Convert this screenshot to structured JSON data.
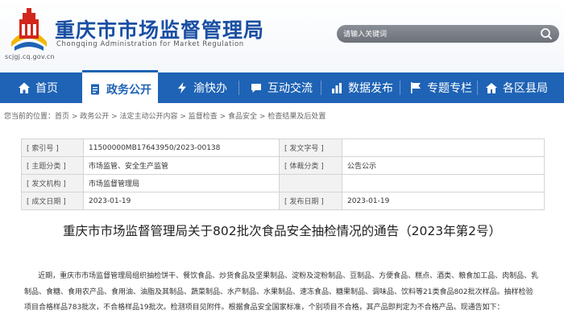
{
  "header": {
    "site_title": "重庆市市场监督管理局",
    "site_subtitle": "Chongqing  Administration  for  Market  Regulation",
    "domain": "scjgj.cq.gov.cn",
    "logo_icon": "city-landmark-logo-icon",
    "colors": {
      "primary": "#1e63b5",
      "logo_red": "#d2261d",
      "logo_yellow": "#f2b705"
    }
  },
  "search": {
    "placeholder": "请输入关键词",
    "icon": "search-icon"
  },
  "nav": {
    "items": [
      {
        "label": "首页",
        "icon": "home-icon"
      },
      {
        "label": "政务公开",
        "icon": "document-icon",
        "active": true
      },
      {
        "label": "渝快办",
        "icon": "lightning-icon"
      },
      {
        "label": "互动交流",
        "icon": "chat-icon"
      },
      {
        "label": "数据发布",
        "icon": "chart-icon"
      },
      {
        "label": "专题专栏",
        "icon": "flag-icon"
      },
      {
        "label": "各区县局",
        "icon": "building-icon"
      }
    ]
  },
  "breadcrumb": "您当前的位置：首页 > 政务公开 > 法定主动公开内容 > 监督检查 > 食品安全 > 检查结果及后处置",
  "info_table": {
    "rows": [
      {
        "label1": "[ 索引号 ]",
        "value1": "11500000MB17643950/2023-00138",
        "label2": "[ 发文字号 ]",
        "value2": ""
      },
      {
        "label1": "[ 主题分类 ]",
        "value1": "市场监管、安全生产监管",
        "label2": "[ 体裁分类 ]",
        "value2": "公告公示"
      },
      {
        "label1": "[ 发文机构 ]",
        "value1": "市场监督管理局",
        "label2": "",
        "value2": ""
      },
      {
        "label1": "[ 成文日期 ]",
        "value1": "2023-01-19",
        "label2": "[ 发布日期 ]",
        "value2": "2023-01-19"
      }
    ]
  },
  "document": {
    "title": "重庆市市场监督管理局关于802批次食品安全抽检情况的通告（2023年第2号）",
    "body": "近期，重庆市市场监督管理局组织抽检饼干、餐饮食品、炒货食品及坚果制品、淀粉及淀粉制品、豆制品、方便食品、糕点、酒类、粮食加工品、肉制品、乳制品、食糖、食用农产品、食用油、油脂及其制品、蔬菜制品、水产制品、水果制品、速冻食品、糖果制品、调味品、饮料等21类食品802批次样品。抽样检验项目合格样品783批次，不合格样品19批次。检测项目见附件。根据食品安全国家标准，个别项目不合格，其产品即判定为不合格产品。现通告如下："
  }
}
